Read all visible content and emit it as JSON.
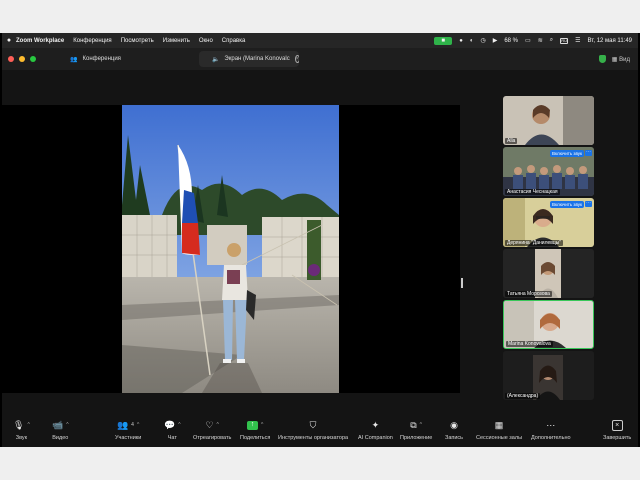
{
  "menubar": {
    "apple": "",
    "items": [
      "Zoom Workplace",
      "Конференция",
      "Посмотреть",
      "Изменить",
      "Окно",
      "Справка"
    ],
    "battery": "68 %",
    "clock": "Вт, 12 мая  11:49"
  },
  "titlebar": {
    "meeting_tab": "Конференция",
    "share_tab": "Экран (Marina Konovalc",
    "view_label": "Вид",
    "traffic_colors": [
      "#ff5f57",
      "#febc2e",
      "#28c840"
    ]
  },
  "gallery": [
    {
      "name": "Alla",
      "unmute": "",
      "active": false
    },
    {
      "name": "Анастасия Чеснацкая",
      "unmute": "Включить звук",
      "active": false
    },
    {
      "name": "Дерянина \"Данилевцы\"",
      "unmute": "Включить звук",
      "active": false
    },
    {
      "name": "Татьяна Морозова",
      "unmute": "",
      "active": false
    },
    {
      "name": "Marina Konovalova",
      "unmute": "",
      "active": true
    },
    {
      "name": "(Александра)",
      "unmute": "",
      "active": false
    }
  ],
  "toolbar": {
    "audio": "Звук",
    "video": "Видео",
    "participants": "Участники",
    "participants_count": "4",
    "chat": "Чат",
    "react": "Отреагировать",
    "share": "Поделиться",
    "host_tools": "Инструменты организатора",
    "ai": "AI Companion",
    "apps": "Приложение",
    "record": "Запись",
    "breakout": "Сессионные залы",
    "more": "Дополнительно",
    "leave": "Завершить"
  },
  "colors": {
    "accent_green": "#39c759",
    "unmute_blue": "#1a73e8",
    "bg_dark": "#141414"
  }
}
